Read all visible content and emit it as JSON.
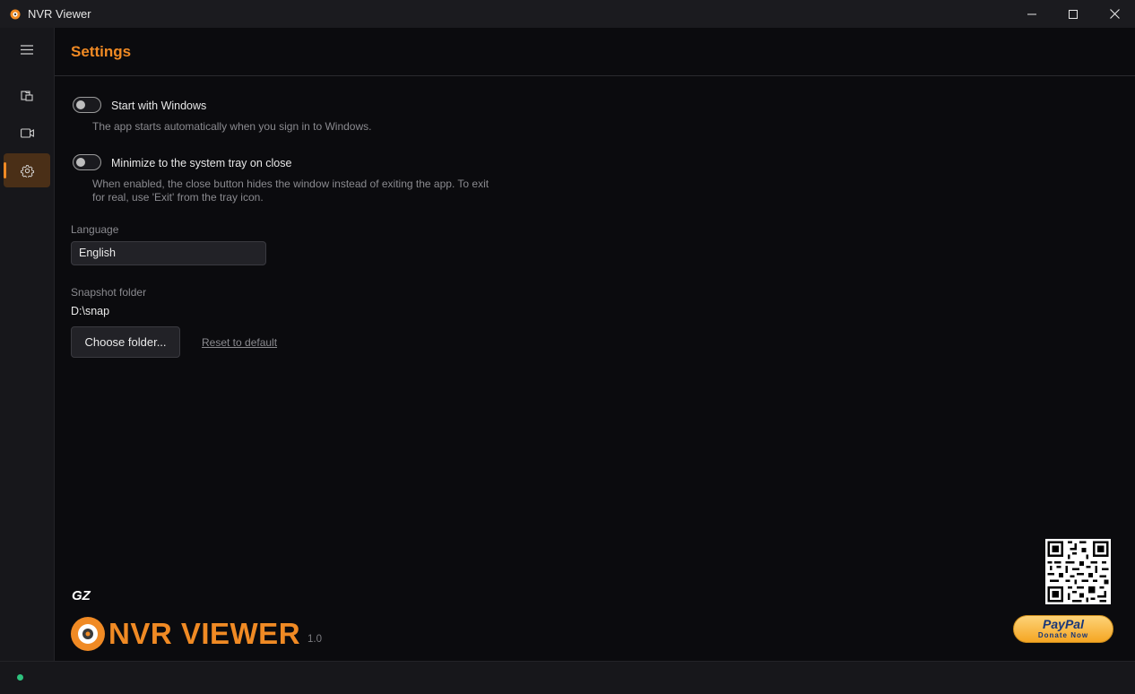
{
  "window": {
    "title": "NVR Viewer"
  },
  "sidebar": {
    "items": [
      {
        "icon": "menu-icon"
      },
      {
        "icon": "folder-icon"
      },
      {
        "icon": "camera-icon"
      },
      {
        "icon": "gear-icon",
        "active": true
      }
    ]
  },
  "settings": {
    "title": "Settings",
    "start_with_windows": {
      "label": "Start with Windows",
      "description": "The app starts automatically when you sign in to Windows.",
      "enabled": false
    },
    "minimize_to_tray": {
      "label": "Minimize to the system tray on close",
      "description": "When enabled, the close button hides the window instead of exiting the app. To exit for real, use 'Exit' from the tray icon.",
      "enabled": false
    },
    "language": {
      "label": "Language",
      "value": "English"
    },
    "snapshot_folder": {
      "label": "Snapshot folder",
      "value": "D:\\snap",
      "choose_button": "Choose folder...",
      "reset_link": "Reset to default"
    }
  },
  "brand": {
    "small_logo_text": "GZ",
    "name": "NVR VIEWER",
    "version": "1.0",
    "accent_color": "#f08a24"
  },
  "donate": {
    "paypal_word": "PayPal",
    "paypal_sub": "Donate Now"
  },
  "status": {
    "indicator_color": "#2ec27e"
  }
}
